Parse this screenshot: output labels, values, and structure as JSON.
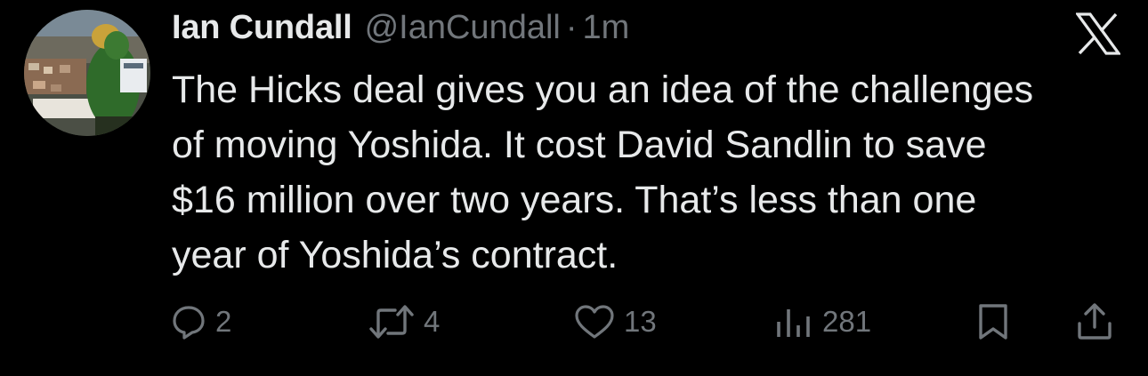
{
  "author": {
    "display_name": "Ian Cundall",
    "handle": "@IanCundall",
    "separator": "·",
    "time": "1m"
  },
  "tweet": {
    "lines": [
      "The Hicks deal gives you an idea of the challenges",
      "of moving Yoshida. It cost David Sandlin to save",
      "$16 million over two years. That’s less than one",
      "year of Yoshida’s contract."
    ]
  },
  "actions": {
    "replies": "2",
    "retweets": "4",
    "likes": "13",
    "views": "281"
  },
  "icons": {
    "platform": "x-logo",
    "reply": "reply-icon",
    "retweet": "retweet-icon",
    "like": "heart-icon",
    "views": "views-icon",
    "bookmark": "bookmark-icon",
    "share": "share-icon"
  },
  "colors": {
    "background": "#000000",
    "text": "#e7e9ea",
    "secondary": "#71767b"
  }
}
